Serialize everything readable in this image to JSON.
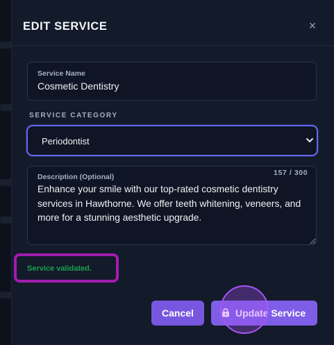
{
  "modal": {
    "title": "EDIT SERVICE",
    "close_glyph": "×",
    "close_icon": "close-icon"
  },
  "service_name": {
    "label": "Service Name",
    "value": "Cosmetic Dentistry"
  },
  "category": {
    "section_label": "SERVICE CATEGORY",
    "selected": "Periodontist",
    "chevron_icon": "chevron-down-icon"
  },
  "description": {
    "label": "Description (Optional)",
    "counter": "157 / 300",
    "value": "Enhance your smile with our top-rated cosmetic dentistry services in Hawthorne. We offer teeth whitening, veneers, and more for a stunning aesthetic upgrade."
  },
  "status": {
    "message": "Service validated.",
    "color": "#16a34a",
    "highlight_color": "#a21caf"
  },
  "actions": {
    "cancel_label": "Cancel",
    "update_label": "Update Service",
    "update_icon": "lock-icon",
    "accent_color": "#7857e0"
  }
}
